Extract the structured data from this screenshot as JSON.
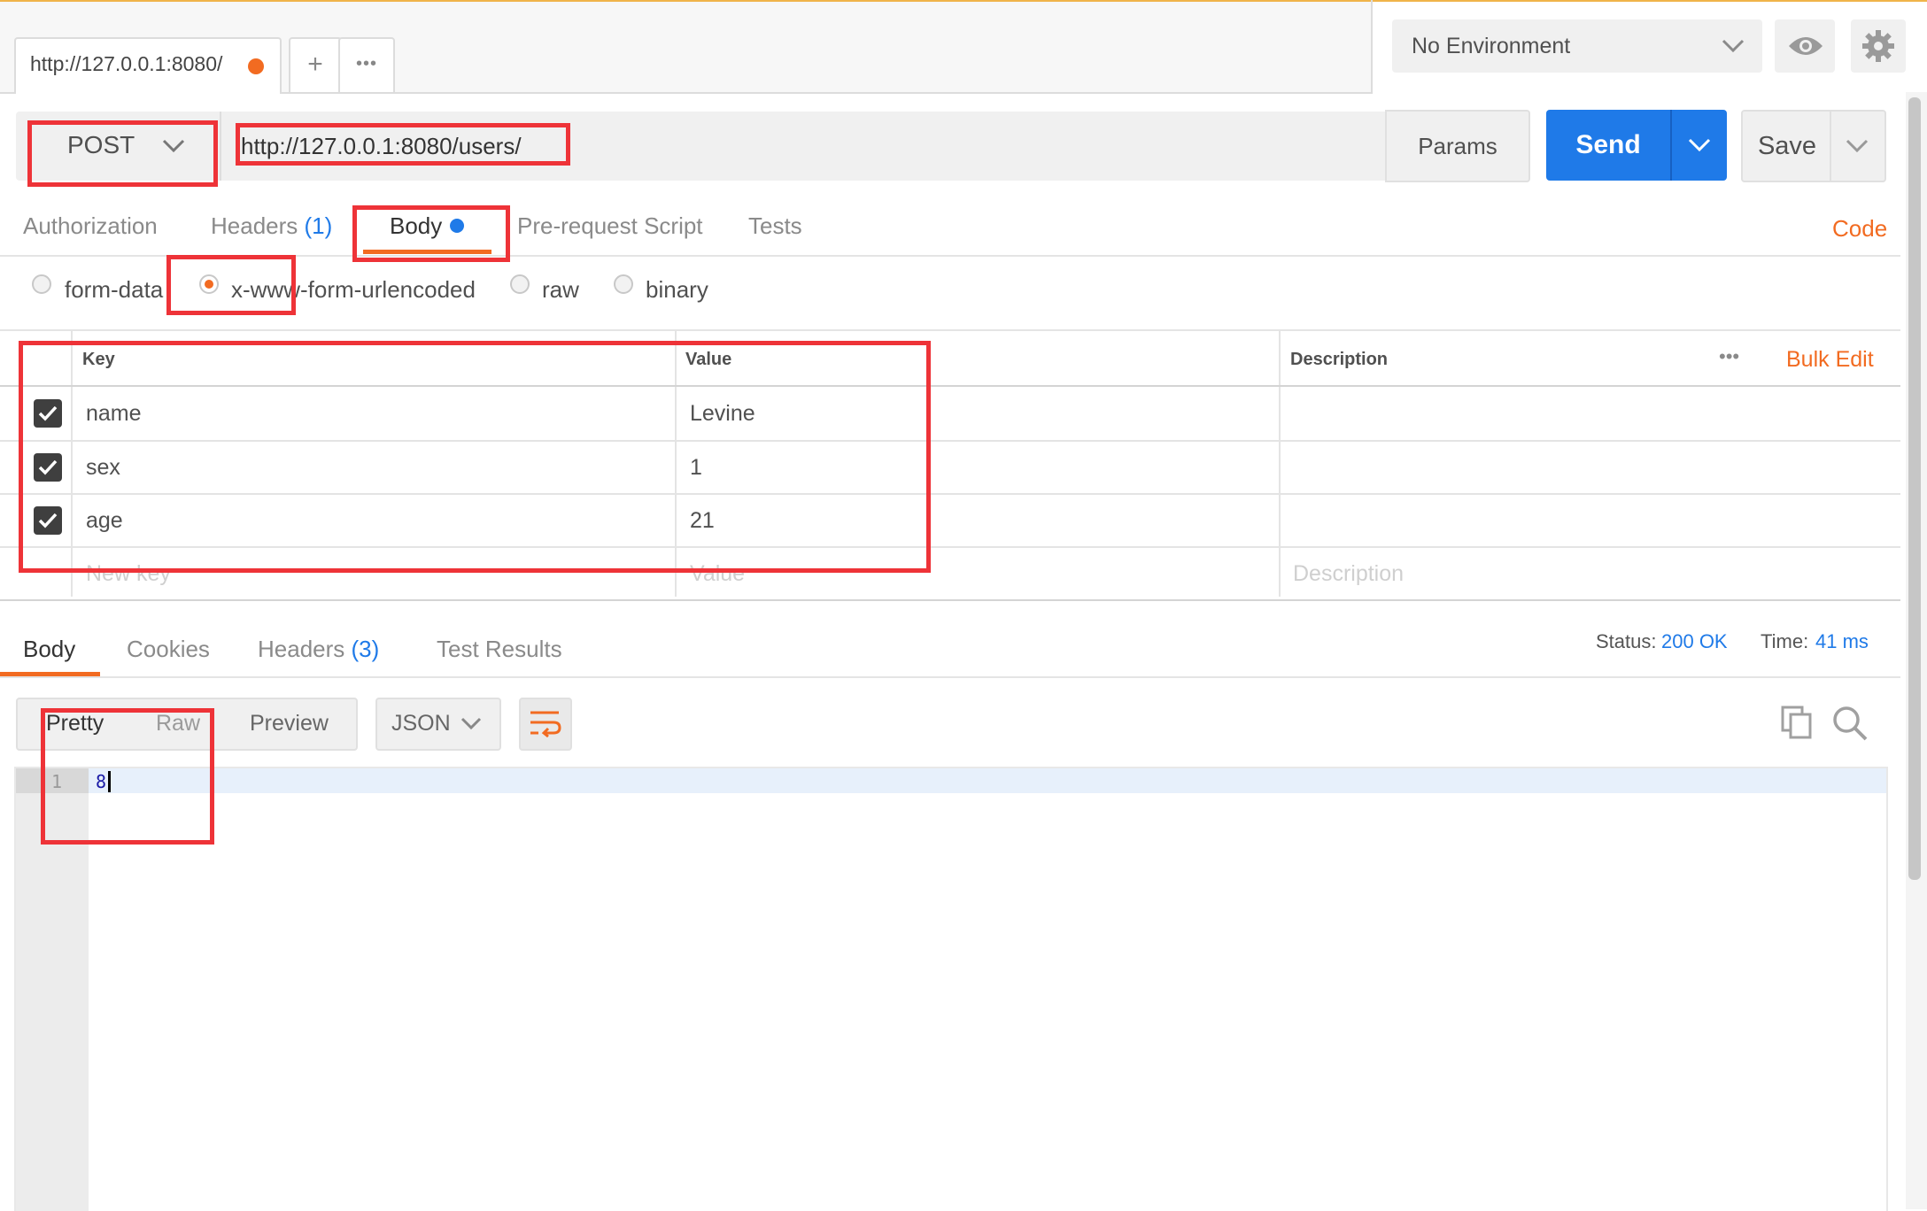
{
  "request_tab": {
    "url": "http://127.0.0.1:8080/"
  },
  "tab_actions": {
    "add": "+",
    "more": "•••"
  },
  "environment": {
    "selected": "No Environment"
  },
  "request": {
    "method": "POST",
    "url": "http://127.0.0.1:8080/users/",
    "params_label": "Params",
    "send_label": "Send",
    "save_label": "Save"
  },
  "request_tabs": {
    "authorization": "Authorization",
    "headers": "Headers",
    "headers_count": "(1)",
    "body": "Body",
    "pre_request": "Pre-request Script",
    "tests": "Tests",
    "code": "Code"
  },
  "body_types": {
    "form_data": "form-data",
    "urlencoded": "x-www-form-urlencoded",
    "raw": "raw",
    "binary": "binary",
    "selected": "x-www-form-urlencoded"
  },
  "params_table": {
    "headers": {
      "key": "Key",
      "value": "Value",
      "description": "Description",
      "bulk_edit": "Bulk Edit",
      "more": "•••"
    },
    "rows": [
      {
        "key": "name",
        "value": "Levine",
        "description": "",
        "checked": true
      },
      {
        "key": "sex",
        "value": "1",
        "description": "",
        "checked": true
      },
      {
        "key": "age",
        "value": "21",
        "description": "",
        "checked": true
      }
    ],
    "new_row": {
      "key_placeholder": "New key",
      "value_placeholder": "Value",
      "description_placeholder": "Description"
    }
  },
  "response": {
    "tabs": {
      "body": "Body",
      "cookies": "Cookies",
      "headers": "Headers",
      "headers_count": "(3)",
      "test_results": "Test Results"
    },
    "status_label": "Status:",
    "status_value": "200 OK",
    "time_label": "Time:",
    "time_value": "41 ms",
    "view_modes": {
      "pretty": "Pretty",
      "raw": "Raw",
      "preview": "Preview"
    },
    "format": "JSON",
    "code": {
      "line_number": "1",
      "content": "8"
    }
  },
  "colors": {
    "accent_orange": "#f26b21",
    "send_blue": "#1f7ae8",
    "annotation_red": "#ee3338"
  }
}
